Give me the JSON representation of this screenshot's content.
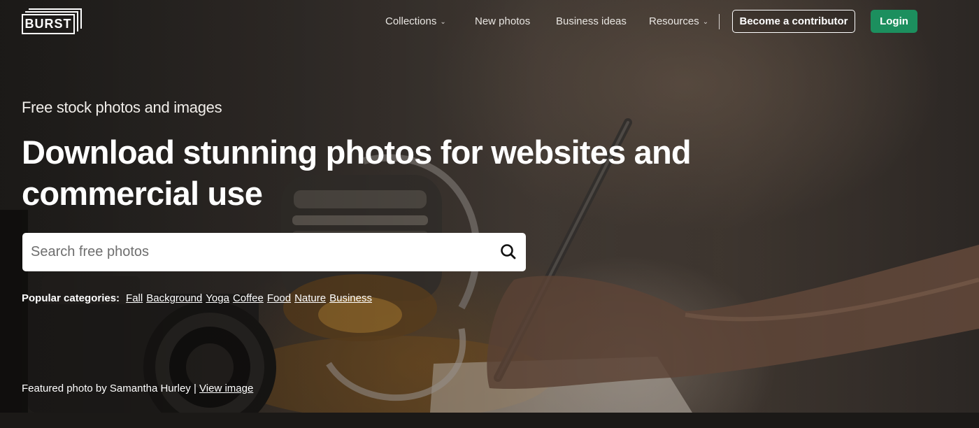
{
  "header": {
    "logo_text": "BURST",
    "nav": [
      {
        "label": "Collections",
        "has_dropdown": true
      },
      {
        "label": "New photos",
        "has_dropdown": false
      },
      {
        "label": "Business ideas",
        "has_dropdown": false
      },
      {
        "label": "Resources",
        "has_dropdown": true
      }
    ],
    "contributor_label": "Become a contributor",
    "login_label": "Login"
  },
  "hero": {
    "eyebrow": "Free stock photos and images",
    "headline_line1": "Download stunning photos for websites and",
    "headline_line2": "commercial use",
    "search_placeholder": "Search free photos",
    "popular_label": "Popular categories:",
    "categories": [
      "Fall",
      "Background",
      "Yoga",
      "Coffee",
      "Food",
      "Nature",
      "Business"
    ],
    "credit_text": "Featured photo by Samantha Hurley |",
    "credit_link": "View image"
  },
  "colors": {
    "login_bg": "#1c8f5e",
    "text": "#ffffff",
    "background": "#1c1a18"
  },
  "icons": [
    "chevron-down-icon",
    "search-icon"
  ]
}
